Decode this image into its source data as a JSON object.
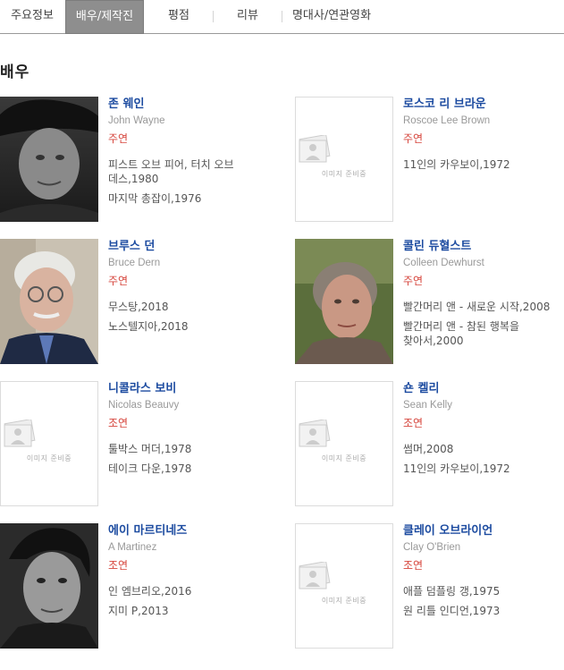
{
  "tabs": [
    {
      "label": "주요정보"
    },
    {
      "label": "배우/제작진",
      "active": true
    },
    {
      "label": "평점"
    },
    {
      "label": "리뷰"
    },
    {
      "label": "명대사/연관영화"
    }
  ],
  "section_title": "배우",
  "placeholder_text": "이미지 준비중",
  "actors": [
    {
      "name_ko": "존 웨인",
      "name_en": "John Wayne",
      "role": "주연",
      "photo": true,
      "films": [
        "피스트 오브 피어, 터치 오브 데스,1980",
        "마지막 총잡이,1976"
      ]
    },
    {
      "name_ko": "로스코 리 브라운",
      "name_en": "Roscoe Lee Brown",
      "role": "주연",
      "photo": false,
      "films": [
        "11인의 카우보이,1972"
      ]
    },
    {
      "name_ko": "브루스 던",
      "name_en": "Bruce Dern",
      "role": "주연",
      "photo": true,
      "films": [
        "무스탕,2018",
        "노스텔지아,2018"
      ]
    },
    {
      "name_ko": "콜린 듀혈스트",
      "name_en": "Colleen Dewhurst",
      "role": "주연",
      "photo": true,
      "films": [
        "빨간머리 앤 - 새로운 시작,2008",
        "빨간머리 앤 - 참된 행복을 찾아서,2000"
      ]
    },
    {
      "name_ko": "니콜라스 보비",
      "name_en": "Nicolas Beauvy",
      "role": "조연",
      "photo": false,
      "films": [
        "툴박스 머더,1978",
        "테이크 다운,1978"
      ]
    },
    {
      "name_ko": "숀 켈리",
      "name_en": "Sean Kelly",
      "role": "조연",
      "photo": false,
      "films": [
        "썸머,2008",
        "11인의 카우보이,1972"
      ]
    },
    {
      "name_ko": "에이 마르티네즈",
      "name_en": "A Martinez",
      "role": "조연",
      "photo": true,
      "films": [
        "인 엠브리오,2016",
        "지미 P,2013"
      ]
    },
    {
      "name_ko": "클레이 오브라이언",
      "name_en": "Clay O'Brien",
      "role": "조연",
      "photo": false,
      "films": [
        "애플 덤플링 갱,1975",
        "원 리틀 인디언,1973"
      ]
    }
  ],
  "colors": {
    "accent_name": "#1c4ba0",
    "role": "#d6453c",
    "tab_active_bg": "#8e8e8e"
  }
}
